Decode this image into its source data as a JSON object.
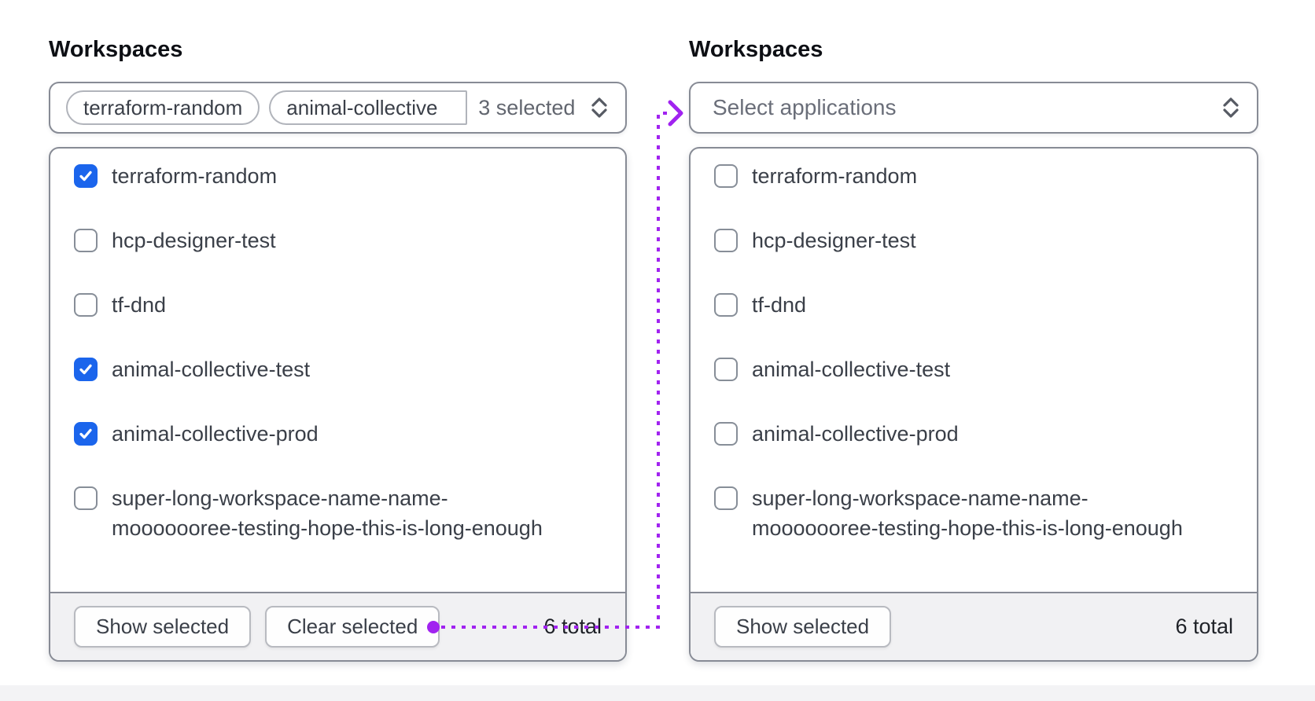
{
  "colors": {
    "accent_blue": "#1b65ec",
    "annotation_purple": "#a123f0",
    "border_gray": "#878b95",
    "footer_bg": "#f1f1f3"
  },
  "icons": {
    "trigger_caret": "chevron-up-down",
    "checkbox_check": "checkmark",
    "connector_arrow": "arrow-right"
  },
  "panels": [
    {
      "title": "Workspaces",
      "trigger": {
        "tags": [
          "terraform-random",
          "animal-collective"
        ],
        "summary": "3 selected"
      },
      "options": [
        {
          "label": "terraform-random",
          "checked": true
        },
        {
          "label": "hcp-designer-test",
          "checked": false
        },
        {
          "label": "tf-dnd",
          "checked": false
        },
        {
          "label": "animal-collective-test",
          "checked": true
        },
        {
          "label": "animal-collective-prod",
          "checked": true
        },
        {
          "label_lines": [
            "super-long-workspace-name-name-",
            "mooooooree-testing-hope-this-is-long-enough"
          ],
          "checked": false
        }
      ],
      "footer": {
        "buttons": [
          "Show selected",
          "Clear selected"
        ],
        "total": "6 total"
      }
    },
    {
      "title": "Workspaces",
      "trigger": {
        "placeholder": "Select applications"
      },
      "options": [
        {
          "label": "terraform-random",
          "checked": false
        },
        {
          "label": "hcp-designer-test",
          "checked": false
        },
        {
          "label": "tf-dnd",
          "checked": false
        },
        {
          "label": "animal-collective-test",
          "checked": false
        },
        {
          "label": "animal-collective-prod",
          "checked": false
        },
        {
          "label_lines": [
            "super-long-workspace-name-name-",
            "mooooooree-testing-hope-this-is-long-enough"
          ],
          "checked": false
        }
      ],
      "footer": {
        "buttons": [
          "Show selected"
        ],
        "total": "6 total"
      }
    }
  ]
}
